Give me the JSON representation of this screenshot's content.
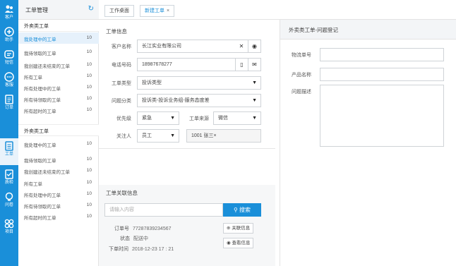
{
  "rail": [
    {
      "icon": "customer-icon",
      "label": "客户"
    },
    {
      "icon": "helper-icon",
      "label": "助手"
    },
    {
      "icon": "sms-icon",
      "label": "短信"
    },
    {
      "icon": "service-icon",
      "label": "客服"
    },
    {
      "icon": "order-icon",
      "label": "订单"
    },
    {
      "icon": "ticket-icon",
      "label": "工单"
    },
    {
      "icon": "quality-icon",
      "label": "质检"
    },
    {
      "icon": "survey-icon",
      "label": "问卷"
    },
    {
      "icon": "project-icon",
      "label": "项目"
    }
  ],
  "nav": {
    "title": "工单管理",
    "group1": "外卖类工单",
    "group1_items": [
      {
        "label": "我处理中的工单",
        "count": "10"
      },
      {
        "label": "我待领取的工单",
        "count": "10"
      },
      {
        "label": "我创建还未结束的工单",
        "count": "10"
      },
      {
        "label": "所有工单",
        "count": "10"
      },
      {
        "label": "所有处理中的工单",
        "count": "10"
      },
      {
        "label": "所有待领取的工单",
        "count": "10"
      },
      {
        "label": "所有超时的工单",
        "count": "10"
      }
    ],
    "group2": "外卖类工单",
    "group2_items": [
      {
        "label": "我处理中的工单",
        "count": "10"
      },
      {
        "label": "我待领取的工单",
        "count": "10"
      },
      {
        "label": "我创建还未结束的工单",
        "count": "10"
      },
      {
        "label": "所有工单",
        "count": "10"
      },
      {
        "label": "所有处理中的工单",
        "count": "10"
      },
      {
        "label": "所有待领取的工单",
        "count": "10"
      },
      {
        "label": "所有超时的工单",
        "count": "10"
      }
    ]
  },
  "tabs": {
    "home": "工作桌面",
    "new_ticket": "新建工单",
    "close": "×"
  },
  "form": {
    "section_title": "工单信息",
    "customer_label": "客户名称",
    "customer_value": "长江实业有限公司",
    "phone_label": "电话号码",
    "phone_value": "18987678277",
    "type_label": "工单类型",
    "type_value": "投诉类型",
    "issue_label": "问题分类",
    "issue_value": "投诉类-投诉业务组-服务态度差",
    "priority_label": "优先级",
    "priority_value": "紧急",
    "source_label": "工单来源",
    "source_value": "微信",
    "assignee_label": "关注人",
    "assignee_value": "员工",
    "assignee_selected": "1001 张三×"
  },
  "related": {
    "section_title": "工单关联信息",
    "search_placeholder": "请输入内容",
    "search_button": "搜索",
    "order_no_label": "订单号",
    "order_no_value": "77287839234567",
    "status_label": "状态",
    "status_value": "配送中",
    "time_label": "下单时间",
    "time_value": "2018-12-23  17 : 21",
    "link_button": "关联信息",
    "view_button": "查看信息"
  },
  "right_panel": {
    "title": "外卖类工单-问题登记",
    "tracking_label": "物流单号",
    "product_label": "产品名称",
    "desc_label": "问题描述"
  },
  "colors": {
    "accent": "#1a8fd9",
    "rail_bg": "#1a8fd9",
    "selected_row_bg": "#e6f1fb"
  }
}
